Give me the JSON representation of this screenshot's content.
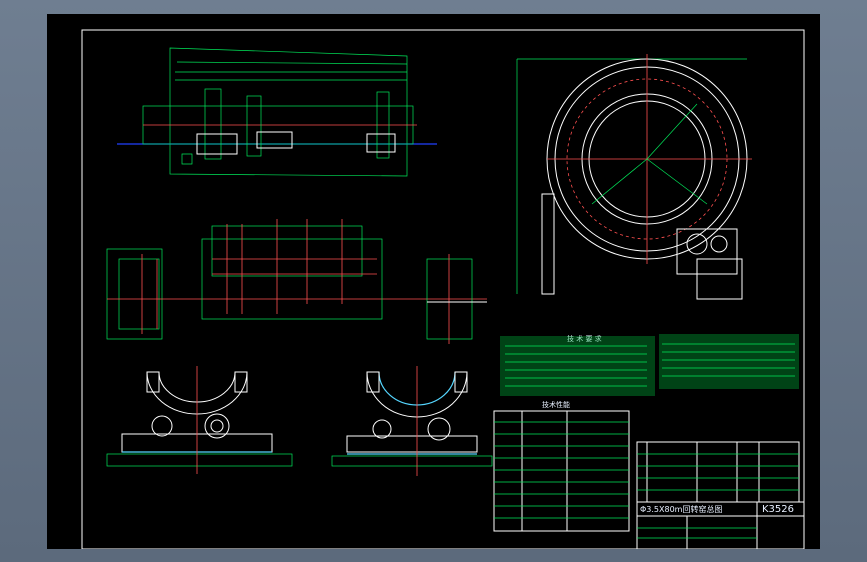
{
  "drawing": {
    "title_block": {
      "drawing_title": "Φ3.5X80m回转窑总图",
      "drawing_number": "K3526"
    },
    "section_titles": {
      "technical_requirements": "技 术 要 求",
      "technical_characteristics": "技术性能"
    },
    "colors": {
      "background": "#000000",
      "frame": "#ffffff",
      "lines": "#00e85a",
      "centerlines": "#ff5050",
      "waterline": "#2040ff",
      "accent": "#55d6ff"
    }
  }
}
